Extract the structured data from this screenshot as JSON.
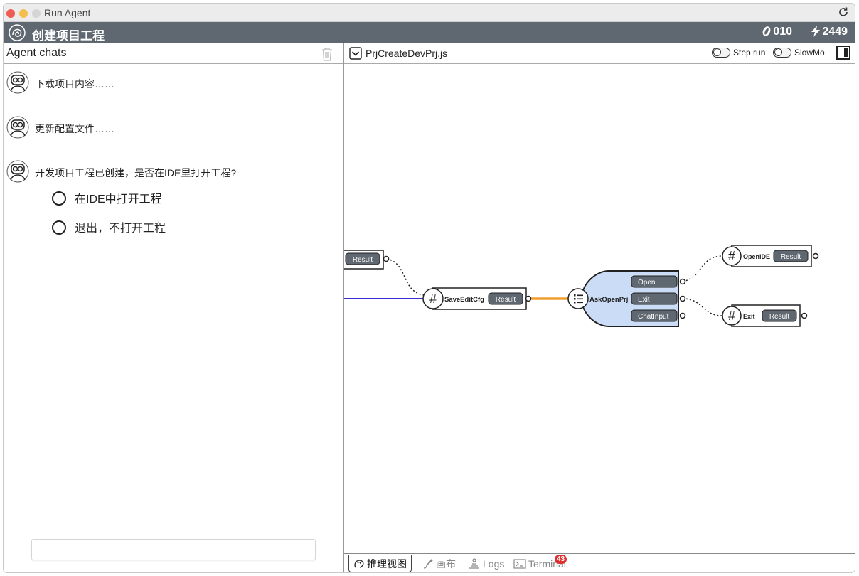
{
  "window": {
    "title": "Run Agent"
  },
  "header": {
    "title": "创建项目工程",
    "coins": "010",
    "energy": "2449"
  },
  "left": {
    "title": "Agent chats",
    "messages": [
      {
        "text": "下载项目内容……"
      },
      {
        "text": "更新配置文件……"
      },
      {
        "text": "开发项目工程已创建，是否在IDE里打开工程?"
      }
    ],
    "options": [
      {
        "label": "在IDE中打开工程"
      },
      {
        "label": "退出，不打开工程"
      }
    ]
  },
  "right": {
    "file": "PrjCreateDevPrj.js",
    "step_run": "Step run",
    "slowmo": "SlowMo",
    "nodes": {
      "partial_result": "Result",
      "save": {
        "name": "SaveEditCfg",
        "out": "Result"
      },
      "ask": {
        "name": "AskOpenPrj",
        "outs": [
          "Open",
          "Exit",
          "ChatInput"
        ]
      },
      "openide": {
        "name": "OpenIDE",
        "out": "Result"
      },
      "exit": {
        "name": "Exit",
        "out": "Result"
      }
    },
    "tabs": [
      {
        "label": "推理视图"
      },
      {
        "label": "画布"
      },
      {
        "label": "Logs"
      },
      {
        "label": "Terminal"
      }
    ],
    "terminal_badge": "43"
  },
  "colors": {
    "header_bg": "#5f6770",
    "ask_node_fill": "#cbdcf7",
    "orange_link": "#f0a030",
    "blue_link": "#3a2fd6",
    "pill_bg": "#5f6770"
  }
}
